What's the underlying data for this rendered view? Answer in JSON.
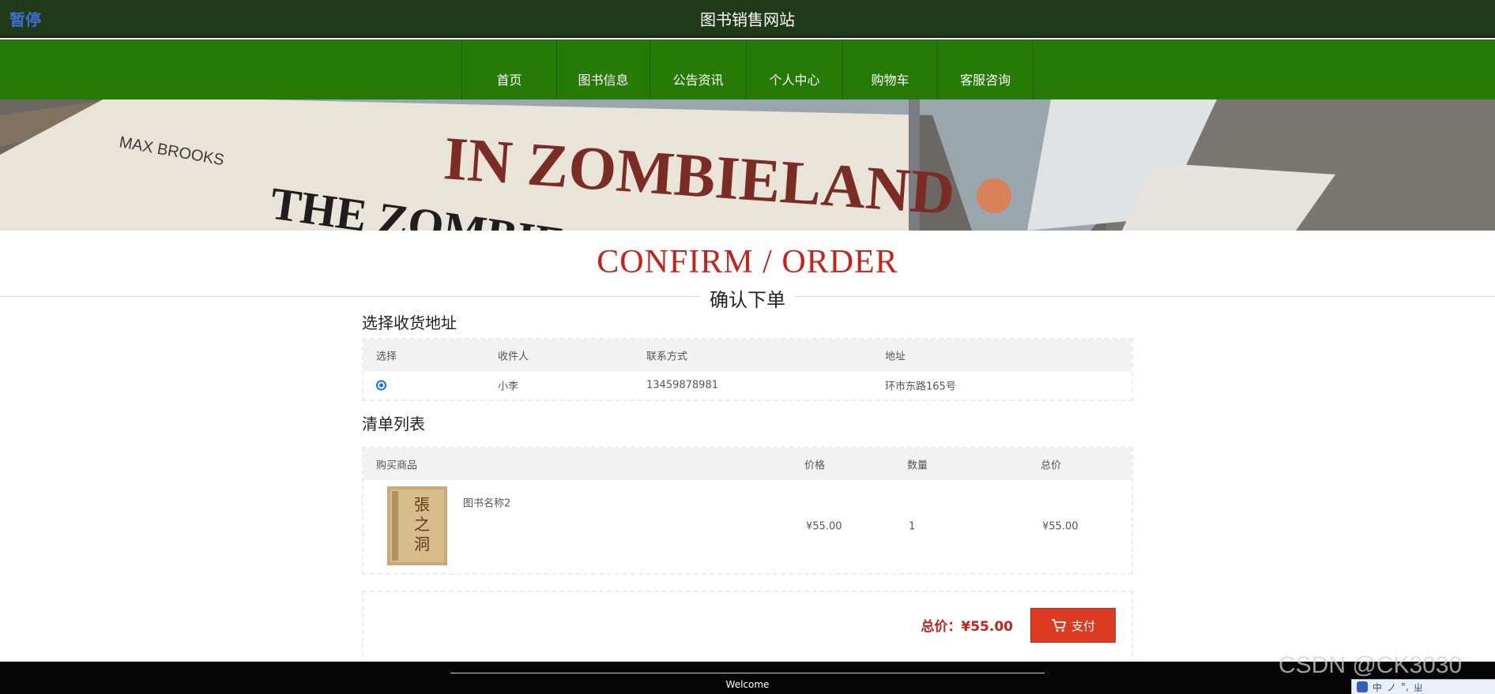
{
  "topbar": {
    "pause_label": "暂停",
    "site_title": "图书销售网站"
  },
  "nav": {
    "items": [
      "首页",
      "图书信息",
      "公告资讯",
      "个人中心",
      "购物车",
      "客服咨询"
    ]
  },
  "banner": {
    "spine_text_1": "IN ZOMBIELAND",
    "spine_text_2": "MAX BROOKS",
    "spine_text_3": "THE ZOMBIE"
  },
  "heading": {
    "title": "CONFIRM / ORDER",
    "subtitle": "确认下单"
  },
  "address_section": {
    "title": "选择收货地址",
    "columns": [
      "选择",
      "收件人",
      "联系方式",
      "地址"
    ],
    "rows": [
      {
        "recipient": "小李",
        "phone": "13459878981",
        "address": "环市东路165号"
      }
    ]
  },
  "list_section": {
    "title": "清单列表",
    "columns": [
      "购买商品",
      "价格",
      "数量",
      "总价"
    ],
    "rows": [
      {
        "name": "图书名称2",
        "price": "¥55.00",
        "quantity": "1",
        "subtotal": "¥55.00",
        "cover_text": "張之洞"
      }
    ]
  },
  "summary": {
    "total_label": "总价：",
    "total_value": "¥55.00",
    "pay_label": "支付"
  },
  "footer": {
    "text": "Welcome"
  },
  "watermark": {
    "text": "CSDN @CK3030"
  },
  "ime": {
    "label_1": "中",
    "label_2": "ノ",
    "label_3": "°,",
    "label_4": "ㄓ"
  },
  "colors": {
    "nav_green": "#267a06",
    "accent_red": "#c7221a",
    "pay_button": "#dc3b22"
  }
}
